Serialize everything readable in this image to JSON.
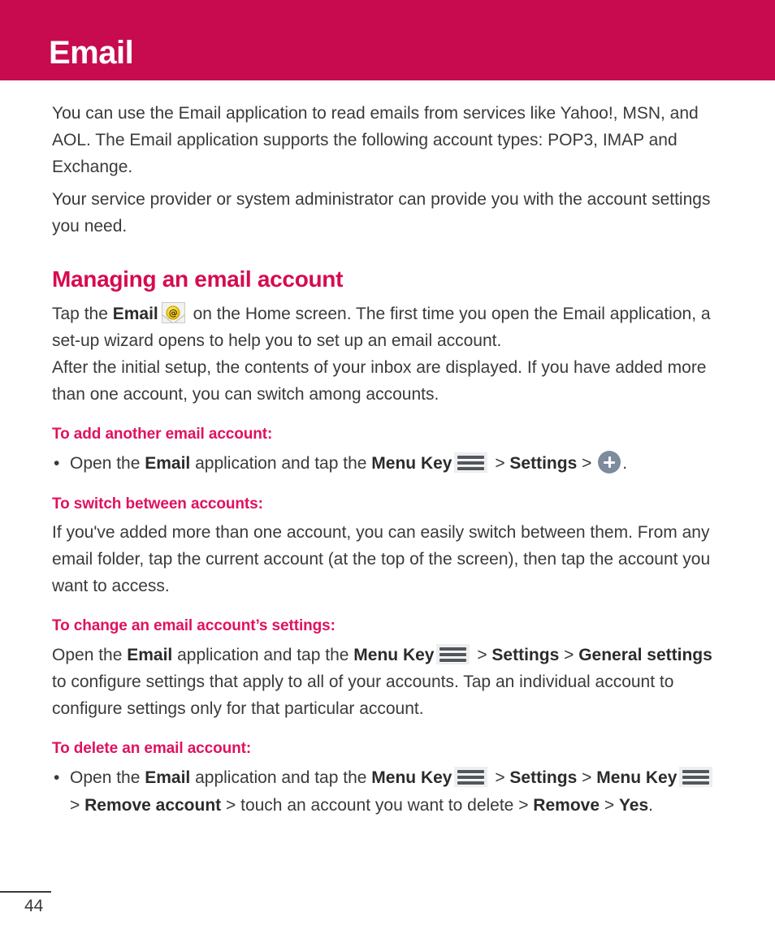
{
  "header": {
    "title": "Email",
    "band_color": "#c80b4e"
  },
  "intro": {
    "paragraph_1": "You can use the Email application to read emails from services like Yahoo!, MSN, and AOL. The Email application supports the following account types: POP3, IMAP and Exchange.",
    "paragraph_2": "Your service provider or system administrator can provide you with the account settings you need."
  },
  "section": {
    "title": "Managing an email account",
    "title_color": "#d60b51",
    "intro_1_a": "Tap the ",
    "intro_1_email": "Email",
    "intro_1_b": " on the Home screen. The first time you open the Email application, a set-up wizard opens to help you to set up an email account.",
    "intro_2": "After the initial setup, the contents of your inbox are displayed. If you have added more than one account, you can switch among accounts."
  },
  "add_account": {
    "heading": "To add another email account:",
    "step_a": "Open the ",
    "step_email": "Email",
    "step_b": " application and tap the ",
    "step_menu_key": "Menu Key",
    "sep": ">",
    "step_settings": "Settings",
    "step_end": "."
  },
  "switch_accounts": {
    "heading": "To switch between accounts:",
    "body": "If you've added more than one account, you can easily switch between them. From any email folder, tap the current account (at the top of the screen), then tap the account you want to access."
  },
  "change_settings": {
    "heading": "To change an email account’s settings:",
    "a": "Open the ",
    "email": "Email",
    "b": " application and tap the ",
    "menu_key": "Menu Key",
    "sep": ">",
    "settings": "Settings",
    "general_settings": "General settings",
    "c": " to configure settings that apply to all of your accounts. Tap an individual account to configure settings only for that particular account."
  },
  "delete_account": {
    "heading": "To delete an email account:",
    "a": "Open the ",
    "email": "Email",
    "b": " application and tap the ",
    "menu_key": "Menu Key",
    "sep": ">",
    "settings": "Settings",
    "menu_key_2": "Menu Key",
    "remove_account": "Remove account",
    "c": " touch an account you want to delete ",
    "remove": "Remove",
    "yes": "Yes",
    "period": "."
  },
  "icons": {
    "email_app": "@",
    "menu_key": "menu-key-icon",
    "plus": "plus-icon"
  },
  "footer": {
    "page_number": "44"
  }
}
